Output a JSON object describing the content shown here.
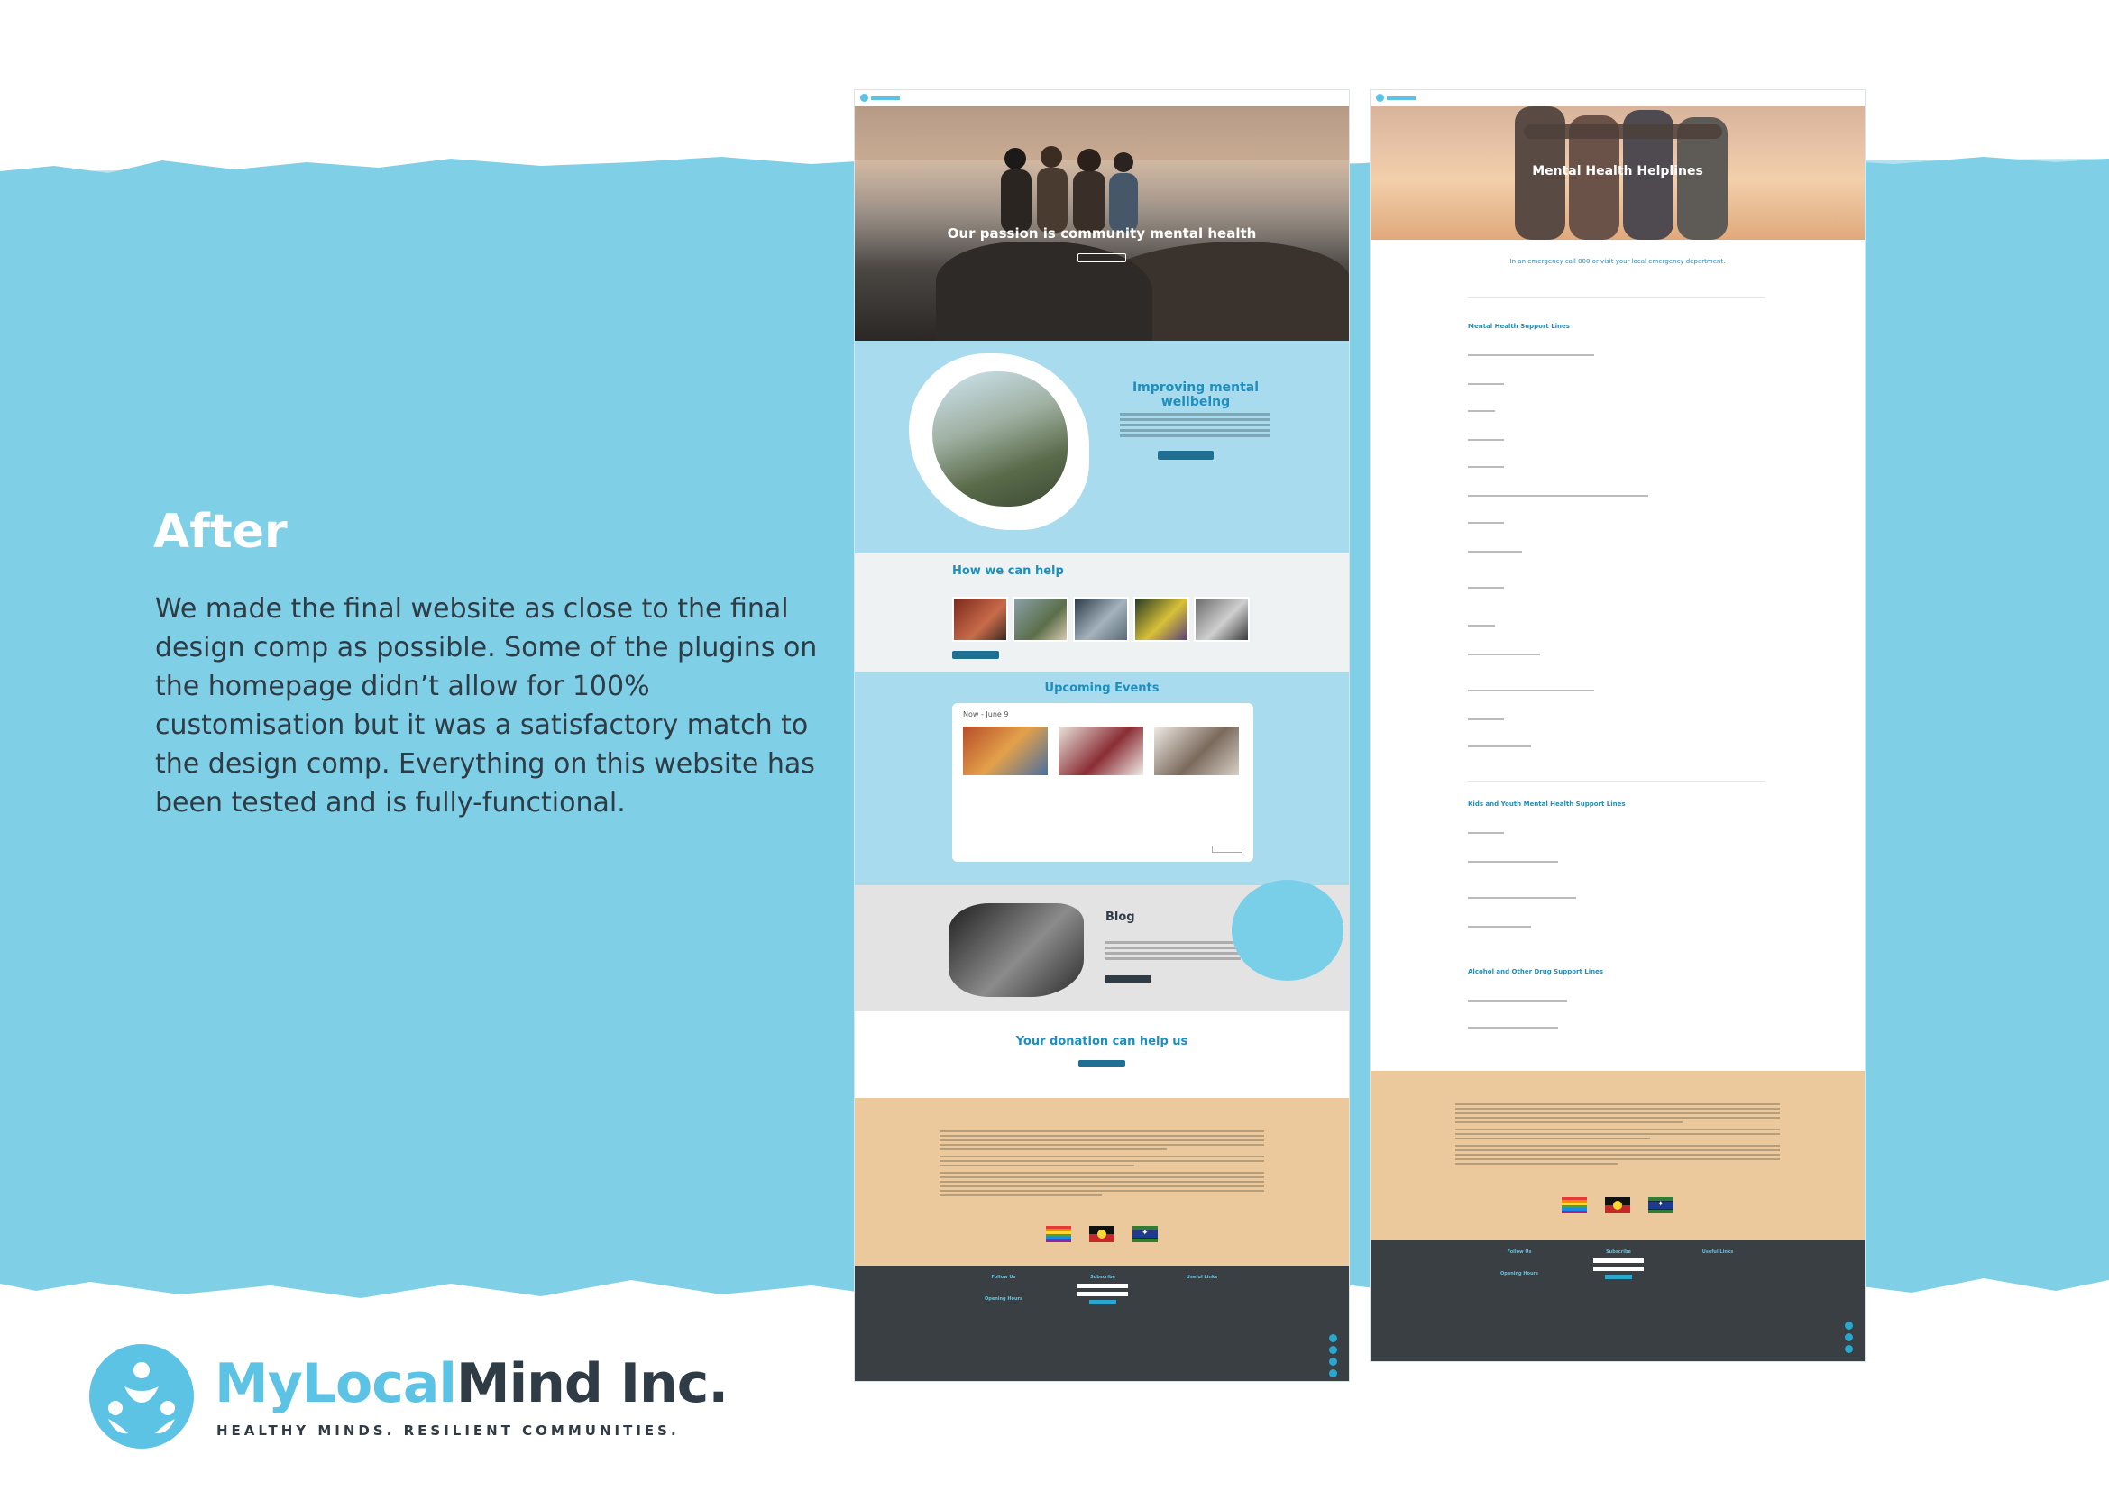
{
  "slide": {
    "heading": "After",
    "body": "We made the final website as close to the final design comp as possible. Some of the plugins on the homepage didn’t allow for 100% customisation but it was a satisfactory match to the design comp. Everything on this website has been tested and is fully-functional.",
    "logo": {
      "name_part1": "MyLocal",
      "name_part2": "Mind Inc.",
      "tagline": "HEALTHY MINDS. RESILIENT COMMUNITIES."
    }
  },
  "colors": {
    "band_blue": "#7fcfe6",
    "brand_blue": "#5cc3e4",
    "heading_blue": "#1d8fbf",
    "ack_tan": "#ebc99c",
    "footer_dark": "#393f43",
    "body_text": "#2f3b45"
  },
  "home_mock": {
    "hero_title": "Our passion is community mental health",
    "improving_title": "Improving mental wellbeing",
    "help_title": "How we can help",
    "events_title": "Upcoming Events",
    "events_now": "Now - June 9",
    "blog_title": "Blog",
    "donation_title": "Your donation can help us",
    "footer": {
      "follow_us": "Follow Us",
      "subscribe": "Subscribe",
      "useful_links": "Useful Links",
      "opening_hours": "Opening Hours"
    }
  },
  "help_mock": {
    "hero_title": "Mental Health Helplines",
    "emergency_line": "In an emergency call 000 or visit your local emergency department.",
    "sections": [
      "Mental Health Support Lines",
      "Kids and Youth Mental Health Support Lines",
      "Alcohol and Other Drug Support Lines"
    ],
    "footer": {
      "follow_us": "Follow Us",
      "subscribe": "Subscribe",
      "useful_links": "Useful Links",
      "opening_hours": "Opening Hours"
    }
  },
  "icons": [
    "pride-flag-icon",
    "aboriginal-flag-icon",
    "torres-strait-flag-icon",
    "scroll-to-top-icon",
    "brand-logo-icon"
  ]
}
